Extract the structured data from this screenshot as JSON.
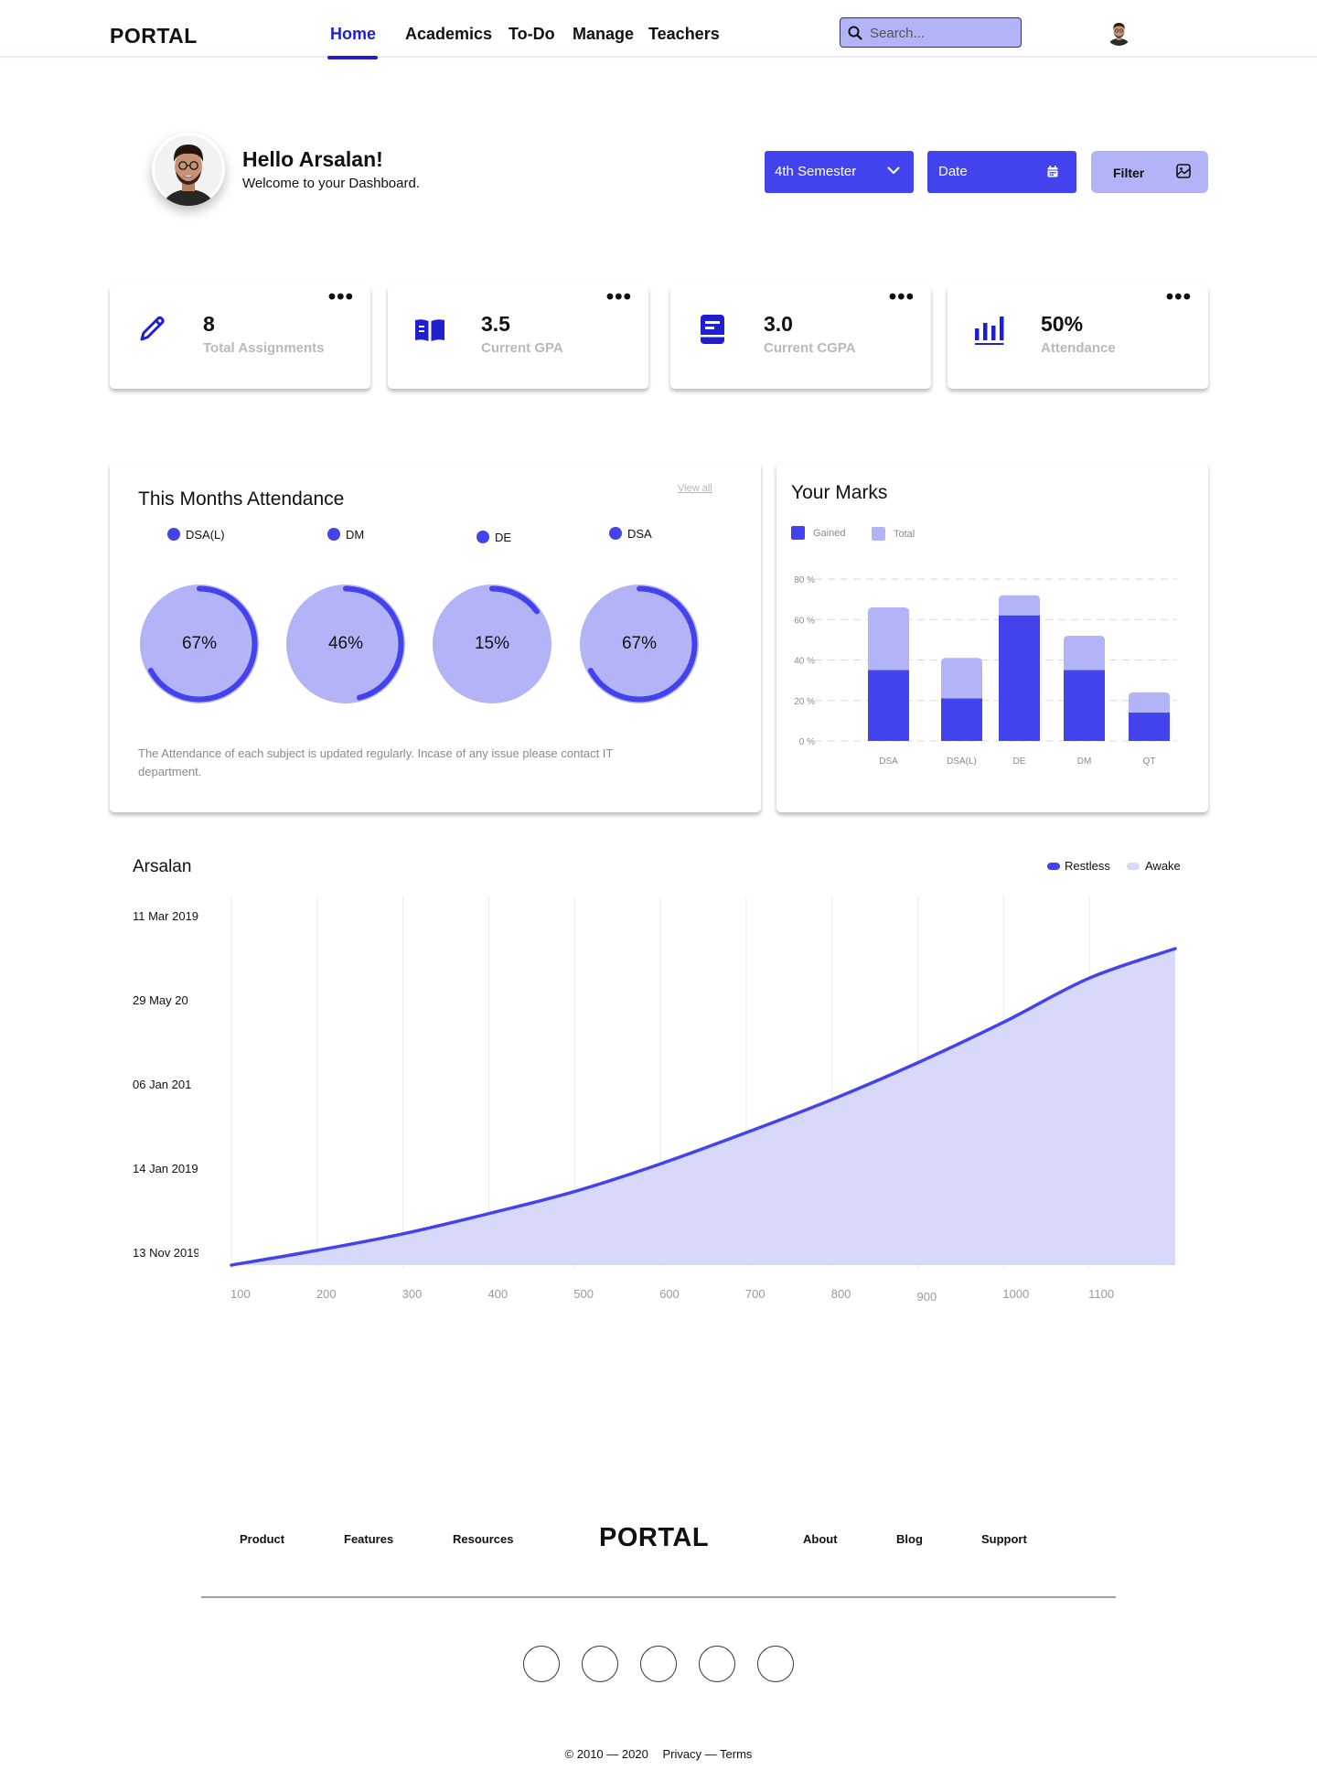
{
  "header": {
    "logo": "PORTAL",
    "nav": [
      {
        "label": "Home",
        "active": true
      },
      {
        "label": "Academics",
        "active": false
      },
      {
        "label": "To-Do",
        "active": false
      },
      {
        "label": "Manage",
        "active": false
      },
      {
        "label": "Teachers",
        "active": false
      }
    ],
    "search_placeholder": "Search..."
  },
  "greeting": {
    "title": "Hello Arsalan!",
    "subtitle": "Welcome to your Dashboard."
  },
  "controls": {
    "semester": "4th Semester",
    "date": "Date",
    "filter": "Filter"
  },
  "stats": [
    {
      "value": "8",
      "label": "Total Assignments",
      "icon": "pencil-icon"
    },
    {
      "value": "3.5",
      "label": "Current GPA",
      "icon": "book-open-icon"
    },
    {
      "value": "3.0",
      "label": "Current CGPA",
      "icon": "book-icon"
    },
    {
      "value": "50%",
      "label": "Attendance",
      "icon": "bar-chart-icon"
    }
  ],
  "attendance": {
    "title": "This Months Attendance",
    "view_all": "View all",
    "subjects": [
      {
        "name": "DSA(L)",
        "percent": 67,
        "label": "67%"
      },
      {
        "name": "DM",
        "percent": 46,
        "label": "46%"
      },
      {
        "name": "DE",
        "percent": 15,
        "label": "15%"
      },
      {
        "name": "DSA",
        "percent": 67,
        "label": "67%"
      }
    ],
    "note": "The Attendance of each subject is updated regularly. Incase of any issue please contact IT department."
  },
  "marks": {
    "title": "Your Marks",
    "legend": [
      "Gained",
      "Total"
    ]
  },
  "colors": {
    "accent": "#4343ee",
    "accent_light": "#b3b3f7",
    "area_fill": "#d8d8fb",
    "nav_active": "#1f1fd1"
  },
  "chart_data": [
    {
      "type": "bar",
      "title": "Your Marks",
      "categories": [
        "DSA",
        "DSA(L)",
        "DE",
        "DM",
        "QT"
      ],
      "series": [
        {
          "name": "Gained",
          "values": [
            35,
            21,
            62,
            35,
            14
          ]
        },
        {
          "name": "Total",
          "values": [
            66,
            41,
            72,
            52,
            24
          ]
        }
      ],
      "yticks": [
        "0 %",
        "20 %",
        "40 %",
        "60 %",
        "80 %"
      ],
      "ylim": [
        0,
        80
      ],
      "grid": true,
      "legend": "top-left"
    },
    {
      "type": "area",
      "title": "Arsalan",
      "legend": [
        {
          "name": "Restless",
          "color": "#4343ee"
        },
        {
          "name": "Awake",
          "color": "#d8d8fb"
        }
      ],
      "xticks": [
        "100",
        "200",
        "300",
        "400",
        "500",
        "600",
        "700",
        "800",
        "900",
        "1000",
        "1100"
      ],
      "yticks": [
        "11 Mar 2019",
        "29 May 20",
        "06 Jan 201",
        "14 Jan 2019",
        "13 Nov 2019"
      ],
      "x": [
        100,
        200,
        300,
        400,
        500,
        600,
        700,
        800,
        900,
        1000,
        1100,
        1200
      ],
      "y": [
        0.0,
        0.04,
        0.085,
        0.14,
        0.2,
        0.275,
        0.36,
        0.45,
        0.55,
        0.66,
        0.78,
        0.86
      ],
      "grid": "vertical"
    }
  ],
  "footer": {
    "left_links": [
      "Product",
      "Features",
      "Resources"
    ],
    "logo": "PORTAL",
    "right_links": [
      "About",
      "Blog",
      "Support"
    ],
    "copyright": "© 2010 — 2020",
    "legal": "Privacy — Terms"
  }
}
